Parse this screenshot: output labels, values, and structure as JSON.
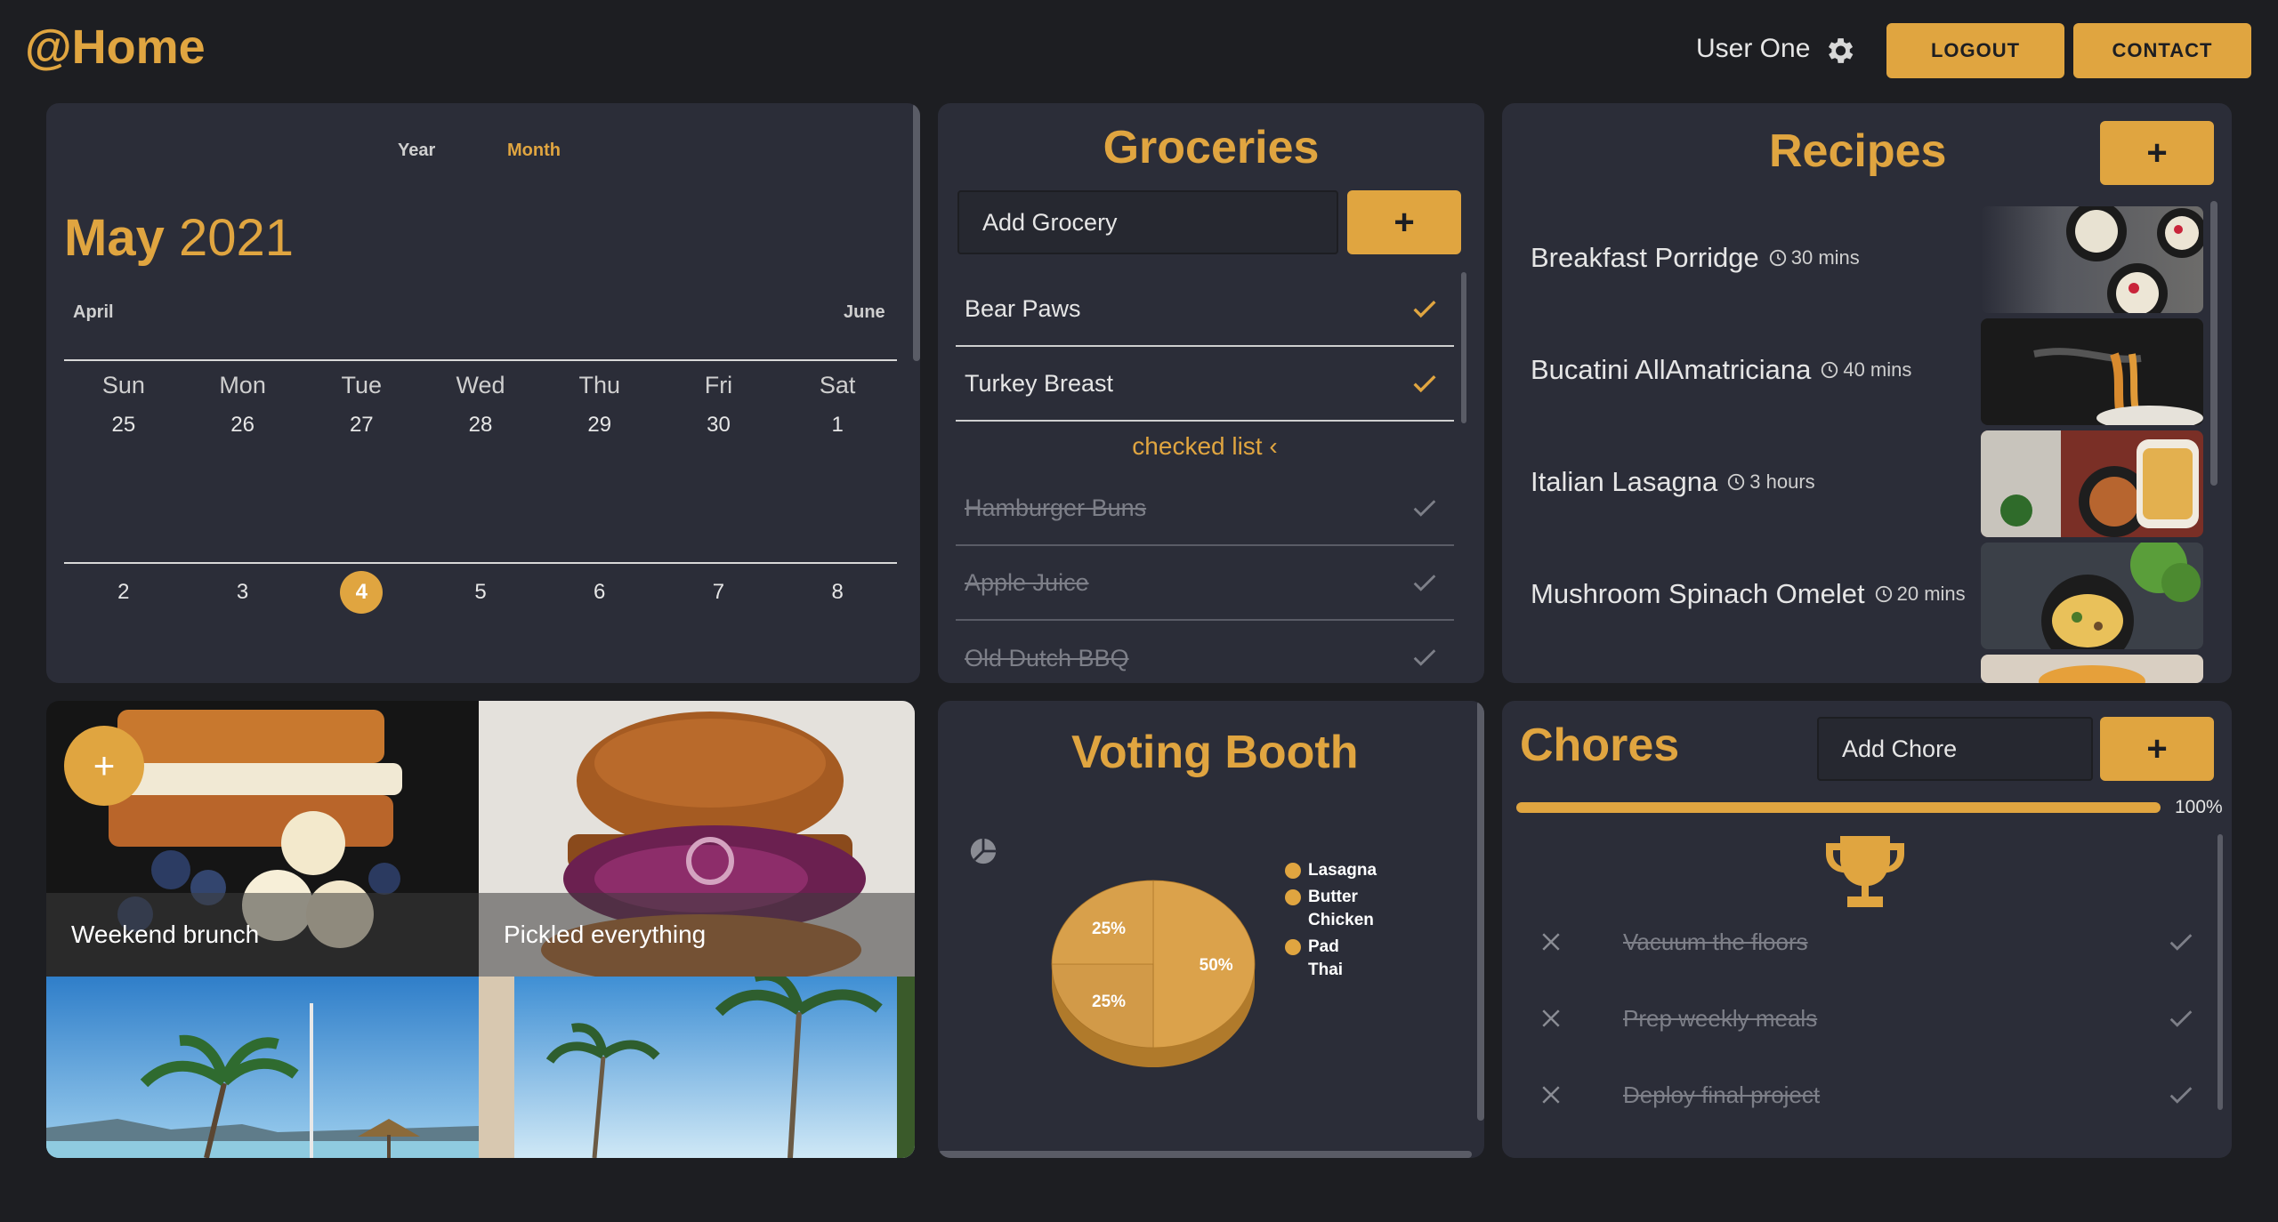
{
  "app": {
    "title": "@Home"
  },
  "header": {
    "user": "User One",
    "logout_label": "LOGOUT",
    "contact_label": "CONTACT"
  },
  "calendar": {
    "views": [
      "Year",
      "Month"
    ],
    "month": "May",
    "year": "2021",
    "prev": "April",
    "next": "June",
    "weekdays": [
      "Sun",
      "Mon",
      "Tue",
      "Wed",
      "Thu",
      "Fri",
      "Sat"
    ],
    "week1": [
      "25",
      "26",
      "27",
      "28",
      "29",
      "30",
      "1"
    ],
    "week2": [
      "2",
      "3",
      "4",
      "5",
      "6",
      "7",
      "8"
    ],
    "today": "4"
  },
  "groceries": {
    "title": "Groceries",
    "placeholder": "Add Grocery",
    "add_label": "+",
    "items": [
      {
        "name": "Bear Paws"
      },
      {
        "name": "Turkey Breast"
      }
    ],
    "checked_toggle": "checked list ‹",
    "checked": [
      {
        "name": "Hamburger Buns"
      },
      {
        "name": "Apple Juice"
      },
      {
        "name": "Old Dutch BBQ"
      }
    ]
  },
  "recipes": {
    "title": "Recipes",
    "add_label": "+",
    "items": [
      {
        "name": "Breakfast Porridge",
        "time": "30 mins"
      },
      {
        "name": "Bucatini AllAmatriciana",
        "time": "40 mins"
      },
      {
        "name": "Italian Lasagna",
        "time": "3 hours"
      },
      {
        "name": "Mushroom Spinach Omelet",
        "time": "20 mins"
      }
    ]
  },
  "gallery": {
    "add_label": "+",
    "tiles": [
      {
        "caption": "Weekend brunch"
      },
      {
        "caption": "Pickled everything"
      }
    ]
  },
  "voting": {
    "title": "Voting Booth",
    "chart_data": {
      "type": "pie",
      "categories": [
        "Lasagna",
        "Butter Chicken",
        "Pad Thai"
      ],
      "values": [
        50,
        25,
        25
      ],
      "labels": [
        "50%",
        "25%",
        "25%"
      ]
    },
    "legend": [
      "Lasagna",
      "Butter Chicken",
      "Pad Thai"
    ],
    "accent": "#e0a540"
  },
  "chores": {
    "title": "Chores",
    "placeholder": "Add Chore",
    "add_label": "+",
    "progress": 1.0,
    "progress_label": "100%",
    "items": [
      {
        "name": "Vacuum the floors"
      },
      {
        "name": "Prep weekly meals"
      },
      {
        "name": "Deploy final project"
      }
    ]
  }
}
